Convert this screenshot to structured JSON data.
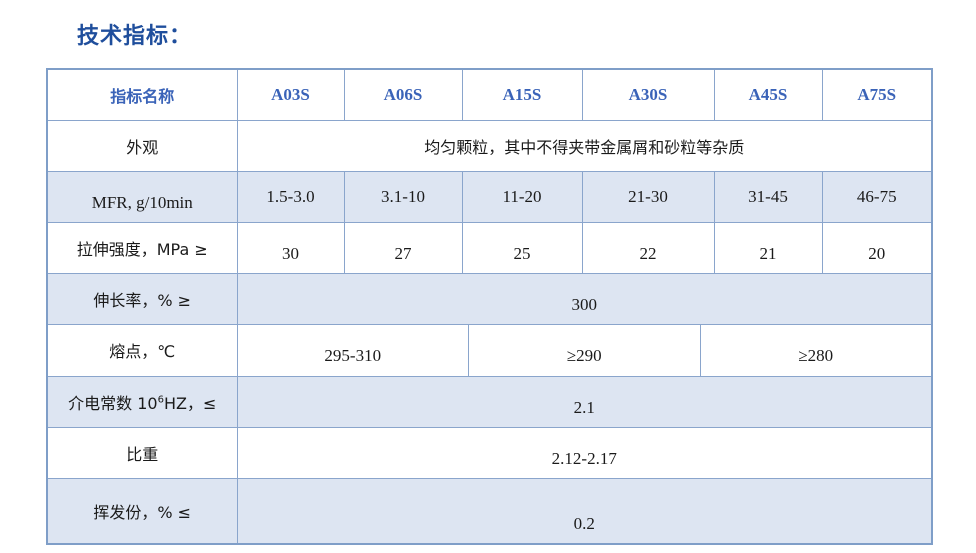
{
  "title": "技术指标：",
  "table": {
    "header": {
      "label": "指标名称",
      "grades": [
        "A03S",
        "A06S",
        "A15S",
        "A30S",
        "A45S",
        "A75S"
      ]
    },
    "rows": {
      "appearance": {
        "label": "外观",
        "value": "均匀颗粒，其中不得夹带金属屑和砂粒等杂质"
      },
      "mfr": {
        "label": "MFR, g/10min",
        "values": [
          "1.5-3.0",
          "3.1-10",
          "11-20",
          "21-30",
          "31-45",
          "46-75"
        ]
      },
      "tensile": {
        "label": "拉伸强度，MPa ≥",
        "values": [
          "30",
          "27",
          "25",
          "22",
          "21",
          "20"
        ]
      },
      "elongation": {
        "label": "伸长率，% ≥",
        "value": "300"
      },
      "melting": {
        "label": "熔点，℃",
        "values": [
          "295-310",
          "≥290",
          "≥280"
        ]
      },
      "dielectric": {
        "label_prefix": "介电常数 10",
        "label_sup": "6",
        "label_suffix": "HZ，≤",
        "value": "2.1"
      },
      "density": {
        "label": "比重",
        "value": "2.12-2.17"
      },
      "volatile": {
        "label": "挥发份，% ≤",
        "value": "0.2"
      }
    }
  },
  "colors": {
    "title": "#1f4e9c",
    "header_text": "#3a63b8",
    "row_shade": "#dde5f2",
    "border": "#8aa5cc"
  }
}
